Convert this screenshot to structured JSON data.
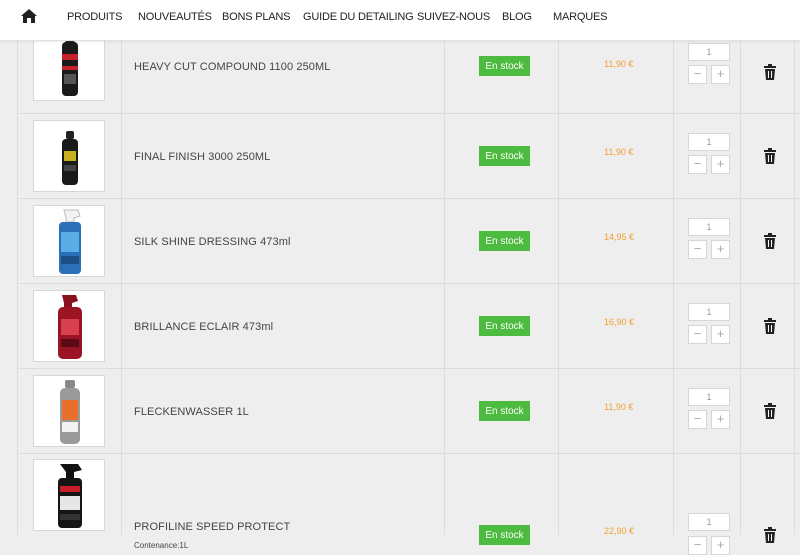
{
  "nav": {
    "home_icon": "home-icon",
    "items": [
      "PRODUITS",
      "NOUVEAUTÉS",
      "BONS PLANS",
      "GUIDE DU DETAILING",
      "SUIVEZ-NOUS",
      "BLOG",
      "MARQUES"
    ]
  },
  "colors": {
    "stock_badge": "#4cbb3f",
    "price": "#f0a030"
  },
  "cart": {
    "items": [
      {
        "name": "HEAVY CUT COMPOUND 1100 250ML",
        "subtitle": "",
        "stock": "En stock",
        "price": "11,90 €",
        "quantity": "1"
      },
      {
        "name": "FINAL FINISH 3000 250ML",
        "subtitle": "",
        "stock": "En stock",
        "price": "11,90 €",
        "quantity": "1"
      },
      {
        "name": "SILK SHINE DRESSING 473ml",
        "subtitle": "",
        "stock": "En stock",
        "price": "14,95 €",
        "quantity": "1"
      },
      {
        "name": "BRILLANCE ECLAIR 473ml",
        "subtitle": "",
        "stock": "En stock",
        "price": "16,90 €",
        "quantity": "1"
      },
      {
        "name": "FLECKENWASSER 1L",
        "subtitle": "",
        "stock": "En stock",
        "price": "11,90 €",
        "quantity": "1"
      },
      {
        "name": "PROFILINE SPEED PROTECT",
        "subtitle": "Contenance:1L",
        "stock": "En stock",
        "price": "22,90 €",
        "quantity": "1"
      }
    ],
    "minus_symbol": "−",
    "plus_symbol": "+"
  }
}
